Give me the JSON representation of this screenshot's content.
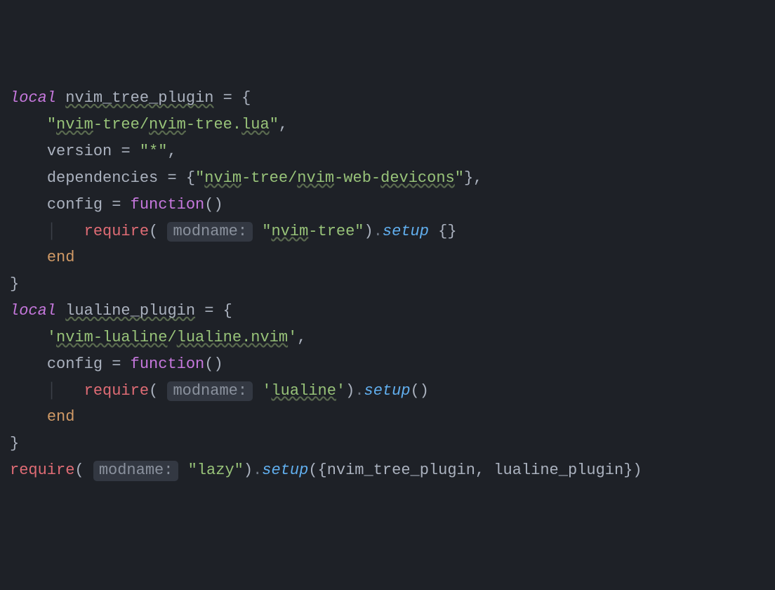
{
  "code": {
    "l1_kw": "local",
    "l1_var": "nvim_tree_plugin",
    "l2_str_pre": "\"",
    "l2_str_us": "nvim",
    "l2_str_mid1": "-tree/",
    "l2_str_us2": "nvim",
    "l2_str_mid2": "-tree.",
    "l2_str_us3": "lua",
    "l2_str_post": "\"",
    "l3_key": "version",
    "l3_val": "\"*\"",
    "l4_key": "dependencies",
    "l4_str_pre": "\"",
    "l4_str_us1": "nvim",
    "l4_str_mid1": "-tree/",
    "l4_str_us2": "nvim",
    "l4_str_mid2": "-web-",
    "l4_str_us3": "devicons",
    "l4_str_post": "\"",
    "l5_key": "config",
    "l5_fn": "function",
    "hint": "modname:",
    "l6_req": "require",
    "l6_str_pre": "\"",
    "l6_str_us": "nvim",
    "l6_str_mid": "-tree\"",
    "setup": "setup",
    "l7_end": "end",
    "l9_kw": "local",
    "l9_var": "lualine_plugin",
    "l10_str_pre": "'",
    "l10_str_us1": "nvim-lualine",
    "l10_str_mid": "/",
    "l10_str_us2": "lualine.nvim",
    "l10_str_post": "'",
    "l11_key": "config",
    "l11_fn": "function",
    "l12_req": "require",
    "l12_str_pre": "'",
    "l12_str_us": "lualine",
    "l12_str_post": "'",
    "l13_end": "end",
    "l15_req": "require",
    "l15_str": "\"lazy\"",
    "l15_arg1": "nvim_tree_plugin",
    "l15_arg2": "lualine_plugin"
  }
}
